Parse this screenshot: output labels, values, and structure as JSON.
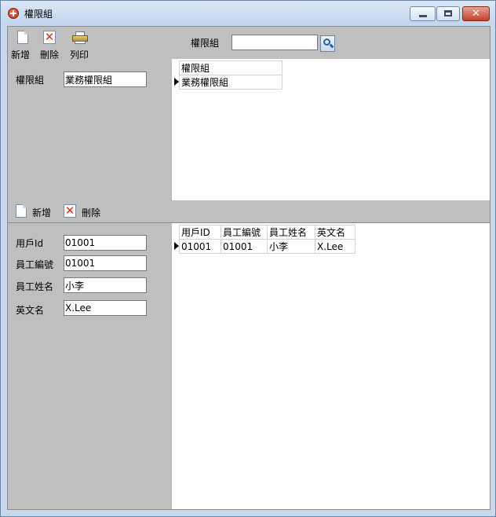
{
  "window": {
    "title": "權限組",
    "minimize_label": "",
    "maximize_label": "",
    "close_label": "✕"
  },
  "toolbar": {
    "new_label": "新增",
    "delete_label": "刪除",
    "print_label": "列印",
    "search_label": "權限組",
    "search_value": ""
  },
  "group_form": {
    "group_label": "權限組",
    "group_value": "業務權限組"
  },
  "group_grid": {
    "columns": [
      "權限組"
    ],
    "rows": [
      [
        "業務權限組"
      ]
    ]
  },
  "detail_toolbar": {
    "new_label": "新增",
    "delete_label": "刪除"
  },
  "user_form": {
    "user_id_label": "用戶Id",
    "user_id_value": "01001",
    "emp_no_label": "員工編號",
    "emp_no_value": "01001",
    "emp_name_label": "員工姓名",
    "emp_name_value": "小李",
    "en_name_label": "英文名",
    "en_name_value": "X.Lee"
  },
  "user_grid": {
    "columns": [
      "用戶ID",
      "員工編號",
      "員工姓名",
      "英文名"
    ],
    "rows": [
      [
        "01001",
        "01001",
        "小李",
        "X.Lee"
      ]
    ]
  },
  "colors": {
    "panel_gray": "#bfbfbf",
    "window_frame": "#c8d9ee",
    "close_red": "#c2412c"
  }
}
